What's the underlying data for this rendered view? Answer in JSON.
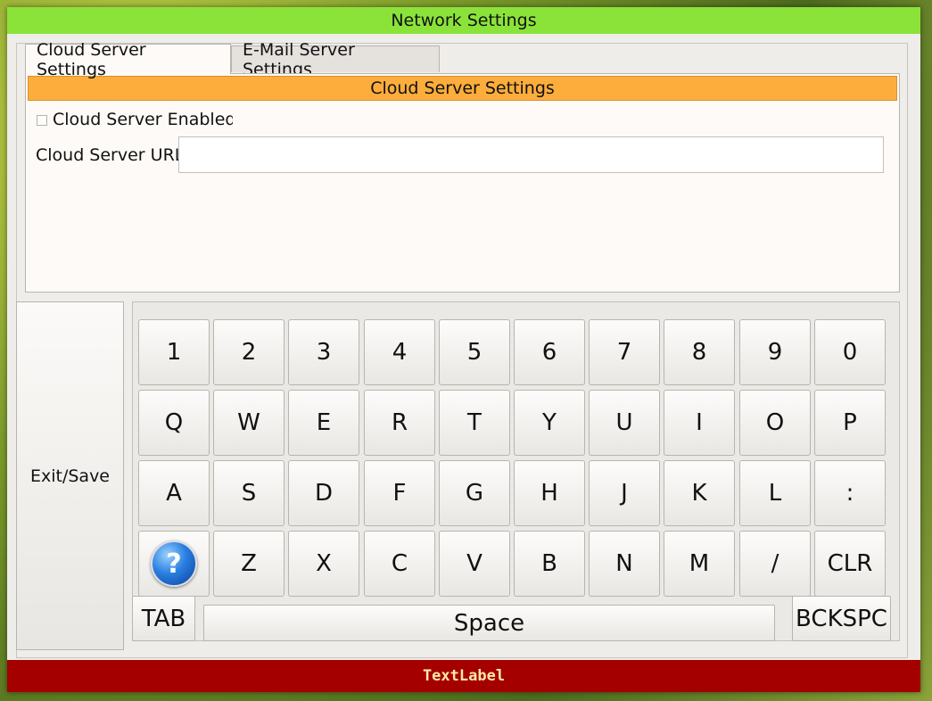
{
  "window": {
    "title": "Network Settings"
  },
  "tabs": [
    {
      "label": "Cloud Server Settings",
      "active": true
    },
    {
      "label": "E-Mail Server Settings",
      "active": false
    }
  ],
  "cloud_panel": {
    "header": "Cloud Server Settings",
    "enabled_label": "Cloud Server Enabled",
    "enabled_checked": false,
    "url_label": "Cloud Server URL",
    "url_value": ""
  },
  "exit_button": "Exit/Save",
  "keyboard": {
    "row1": [
      "1",
      "2",
      "3",
      "4",
      "5",
      "6",
      "7",
      "8",
      "9",
      "0"
    ],
    "row2": [
      "Q",
      "W",
      "E",
      "R",
      "T",
      "Y",
      "U",
      "I",
      "O",
      "P"
    ],
    "row3": [
      "A",
      "S",
      "D",
      "F",
      "G",
      "H",
      "J",
      "K",
      "L",
      ":"
    ],
    "row4": [
      "Z",
      "X",
      "C",
      "V",
      "B",
      "N",
      "M",
      "/",
      "CLR"
    ],
    "tab": "TAB",
    "space": "Space",
    "backspace": "BCKSPC",
    "help_icon": "help-question-icon"
  },
  "status_bar": "TextLabel",
  "colors": {
    "title_bar": "#8be33a",
    "panel_header": "#fcad3c",
    "status_bar": "#a50000",
    "status_text": "#ffe9a8"
  }
}
